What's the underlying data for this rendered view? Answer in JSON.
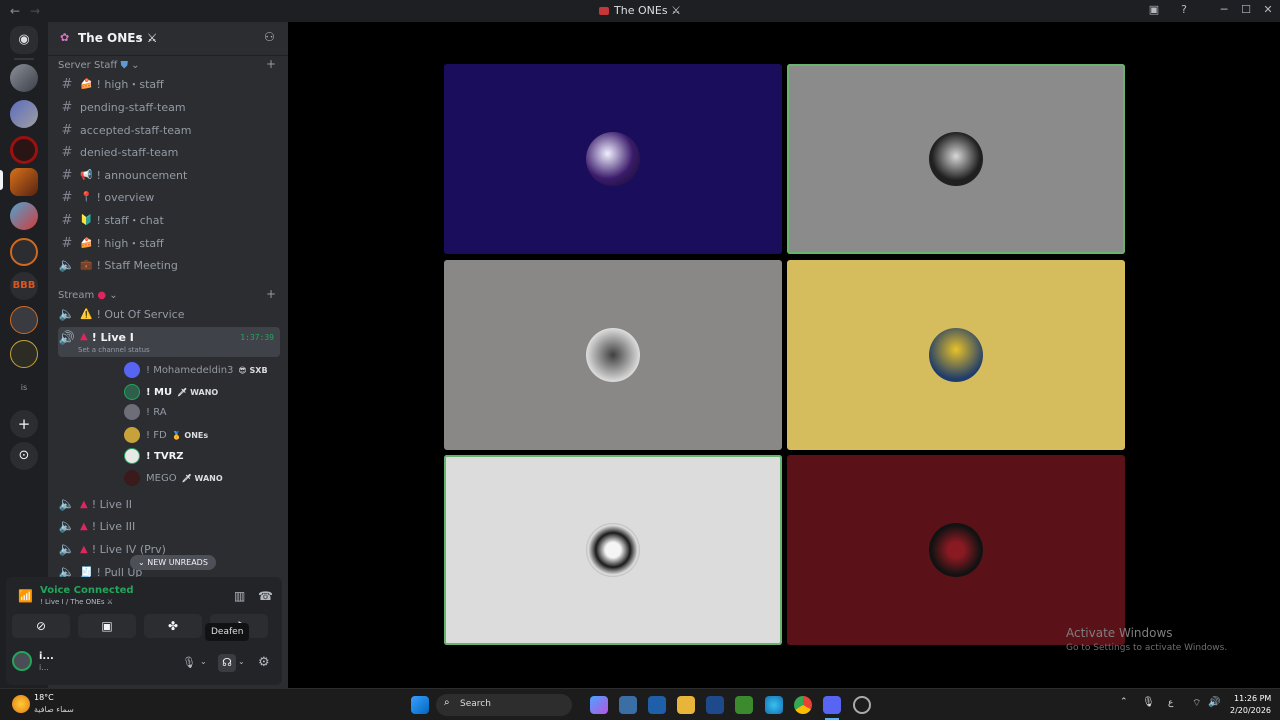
{
  "titlebar": {
    "title": "The ONEs ⚔"
  },
  "server": {
    "name": "The ONEs ⚔"
  },
  "categories": {
    "staff": "Server Staff",
    "stream": "Stream"
  },
  "staff_channels": [
    {
      "emoji": "🍰",
      "label": "! high・staff"
    },
    {
      "emoji": "",
      "label": "pending-staff-team"
    },
    {
      "emoji": "",
      "label": "accepted-staff-team"
    },
    {
      "emoji": "",
      "label": "denied-staff-team"
    },
    {
      "emoji": "📢",
      "label": "! announcement"
    },
    {
      "emoji": "📍",
      "label": "! overview"
    },
    {
      "emoji": "🔰",
      "label": "! staff・chat"
    },
    {
      "emoji": "🍰",
      "label": "! high・staff"
    },
    {
      "emoji": "💼",
      "label": "! Staff Meeting"
    }
  ],
  "stream_channels": {
    "out_of_service": "! Out Of Service",
    "live1": {
      "name": "! Live I",
      "timer": "1:37:39",
      "status": "Set a channel status"
    },
    "live2": "! Live II",
    "live3": "! Live III",
    "live4": "! Live IV (Prv)",
    "pullup": "! Pull Up"
  },
  "voice_users": [
    {
      "name": "! Mohamedeldin3",
      "tag": "😎 SXB"
    },
    {
      "name": "! MU",
      "tag": "🗡 WANO"
    },
    {
      "name": "! RA",
      "tag": ""
    },
    {
      "name": "! FD",
      "tag": "🥇 ONEs"
    },
    {
      "name": "! TVRZ",
      "tag": ""
    },
    {
      "name": "MEGO",
      "tag": "🗡 WANO"
    }
  ],
  "new_unreads": "NEW UNREADS",
  "voice": {
    "status": "Voice Connected",
    "channel": "! Live I / The ONEs ⚔"
  },
  "user_panel": {
    "name": "i...",
    "sub": "i...",
    "tooltip": "Deafen"
  },
  "tiles_colors": [
    "#1a0e5c",
    "#8b8b8b",
    "#8a8886",
    "#d5bc5d",
    "#dcdcdc",
    "#5a1218"
  ],
  "watermark": {
    "line1": "Activate Windows",
    "line2": "Go to Settings to activate Windows."
  },
  "taskbar": {
    "weather_temp": "18°C",
    "weather_desc": "سماء صافية",
    "search": "Search",
    "time": "11:26 PM",
    "date": "2/20/2026",
    "lang": "ع"
  }
}
